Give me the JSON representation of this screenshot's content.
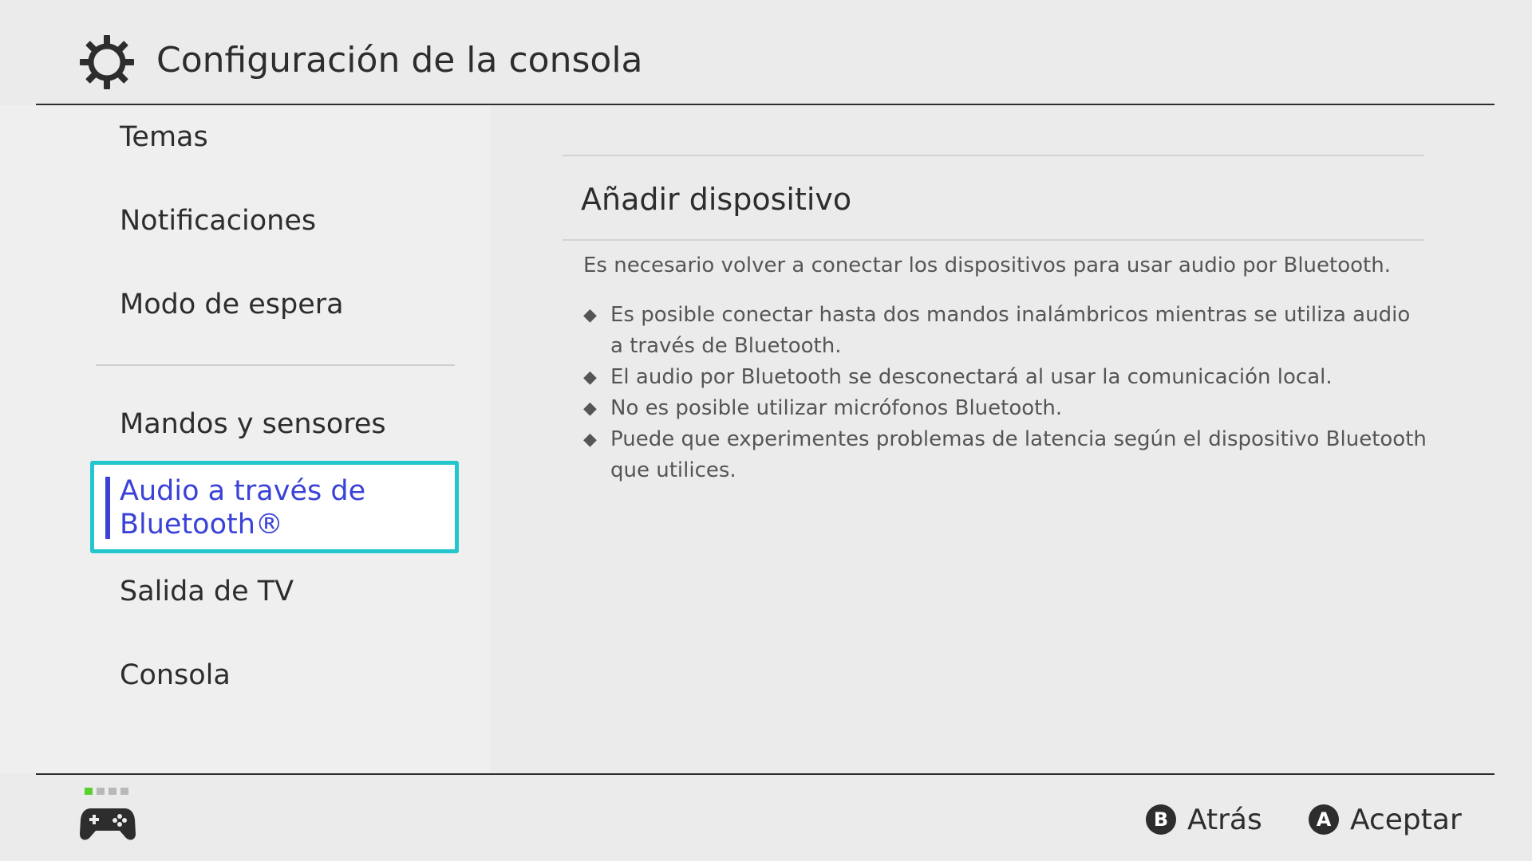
{
  "header": {
    "title": "Configuración de la consola",
    "icon": "gear-icon"
  },
  "sidebar": {
    "items": [
      {
        "label": "Temas"
      },
      {
        "label": "Notificaciones"
      },
      {
        "label": "Modo de espera"
      },
      {
        "label": "Mandos y sensores"
      },
      {
        "label": "Audio a través de Bluetooth®",
        "selected": true
      },
      {
        "label": "Salida de TV"
      },
      {
        "label": "Consola"
      }
    ]
  },
  "main": {
    "section_title": "Añadir dispositivo",
    "description": "Es necesario volver a conectar los dispositivos para usar audio por Bluetooth.",
    "bullets": [
      "Es posible conectar hasta dos mandos inalámbricos mientras se utiliza audio a través de Bluetooth.",
      "El audio por Bluetooth se desconectará al usar la comunicación local.",
      "No es posible utilizar micrófonos Bluetooth.",
      "Puede que experimentes problemas de latencia según el dispositivo Bluetooth que utilices."
    ],
    "bullet_glyph": "◆"
  },
  "footer": {
    "controller_icon": "controller-icon",
    "player_indicator": {
      "active": 1,
      "total": 4
    },
    "back": {
      "key": "B",
      "label": "Atrás"
    },
    "accept": {
      "key": "A",
      "label": "Aceptar"
    }
  },
  "colors": {
    "background": "#ebebeb",
    "selection_border": "#23c6cc",
    "selection_text": "#3a42d8",
    "player_active": "#5bd12e",
    "player_inactive": "#b8b8b8"
  }
}
